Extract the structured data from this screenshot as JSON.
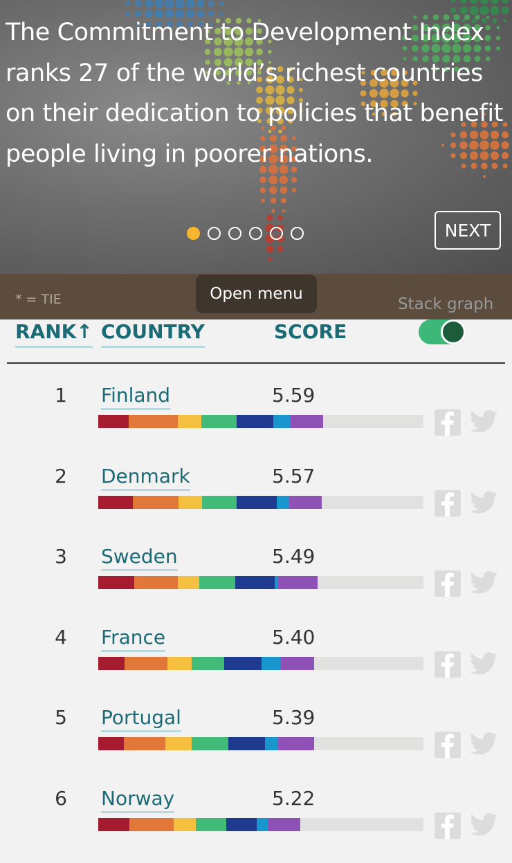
{
  "hero": {
    "text": "The Commitment to Development Index ranks 27 of the world’s richest countries on their dedication to policies that benefit people living in poorer nations.",
    "next_label": "NEXT",
    "slides": 6,
    "active_slide": 1
  },
  "toolbar": {
    "tie_note": "* = TIE",
    "open_menu_label": "Open menu",
    "stack_graph_label": "Stack graph"
  },
  "table": {
    "headers": {
      "rank": "RANK↑",
      "country": "COUNTRY",
      "score": "SCORE"
    },
    "stack_graph_on": true,
    "segment_colors": [
      "#a51c30",
      "#e2773a",
      "#f5c040",
      "#43bb78",
      "#1e3b8f",
      "#1a96cf",
      "#8e52b6"
    ],
    "rows": [
      {
        "rank": "1",
        "country": "Finland",
        "score": "5.59",
        "segments": [
          0.59,
          0.97,
          0.46,
          0.68,
          0.72,
          0.34,
          0.63
        ]
      },
      {
        "rank": "2",
        "country": "Denmark",
        "score": "5.57",
        "segments": [
          0.68,
          0.89,
          0.46,
          0.67,
          0.78,
          0.25,
          0.63
        ]
      },
      {
        "rank": "3",
        "country": "Sweden",
        "score": "5.49",
        "segments": [
          0.7,
          0.86,
          0.41,
          0.71,
          0.76,
          0.07,
          0.78
        ]
      },
      {
        "rank": "4",
        "country": "France",
        "score": "5.40",
        "segments": [
          0.51,
          0.84,
          0.47,
          0.64,
          0.73,
          0.38,
          0.65
        ]
      },
      {
        "rank": "5",
        "country": "Portugal",
        "score": "5.39",
        "segments": [
          0.5,
          0.81,
          0.52,
          0.71,
          0.72,
          0.25,
          0.71
        ]
      },
      {
        "rank": "6",
        "country": "Norway",
        "score": "5.22",
        "segments": [
          0.61,
          0.86,
          0.44,
          0.59,
          0.59,
          0.23,
          0.62
        ]
      }
    ]
  },
  "icons": {
    "share_facebook": "facebook-icon",
    "share_twitter": "twitter-icon"
  }
}
